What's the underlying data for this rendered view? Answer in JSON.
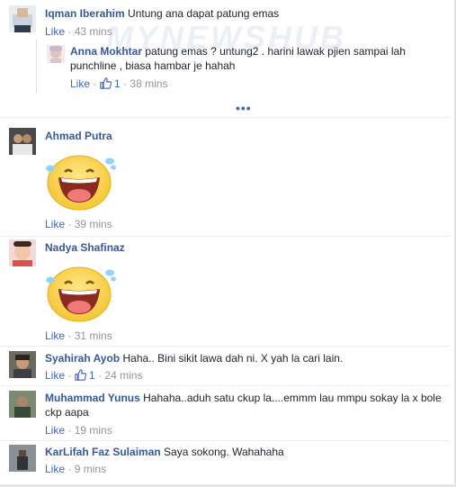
{
  "comments": [
    {
      "name": "Iqman Iberahim",
      "text": "Untung ana dapat patung emas",
      "like": "Like",
      "sep": "·",
      "time": "43 mins"
    },
    {
      "name": "Anna Mokhtar",
      "text": "patung emas ? untung2 . harini lawak pjien sampai lah punchline , biasa hambar je hahah",
      "like": "Like",
      "sep": "·",
      "likes": "1",
      "sep2": "·",
      "time": "38 mins"
    },
    {
      "name": "Ahmad Putra",
      "like": "Like",
      "sep": "·",
      "time": "39 mins",
      "sticker": "laughing-tears-sticker"
    },
    {
      "name": "Nadya Shafinaz",
      "like": "Like",
      "sep": "·",
      "time": "31 mins",
      "sticker": "laughing-tears-sticker"
    },
    {
      "name": "Syahirah Ayob",
      "text": "Haha.. Bini sikit lawa dah ni. X yah la cari lain.",
      "like": "Like",
      "sep": "·",
      "likes": "1",
      "sep2": "·",
      "time": "24 mins"
    },
    {
      "name": "Muhammad Yunus",
      "text": "Hahaha..aduh satu ckup la....emmm lau mmpu sokay la x bole ckp aapa",
      "like": "Like",
      "sep": "·",
      "time": "19 mins"
    },
    {
      "name": "KarLifah Faz Sulaiman",
      "text": "Saya sokong. Wahahaha",
      "like": "Like",
      "sep": "·",
      "time": "9 mins"
    }
  ],
  "more_replies": "•••",
  "colors": {
    "name": "#365899",
    "link": "#4267b2",
    "meta": "#90949c",
    "text": "#1d2129"
  },
  "icons": {
    "thumb": "thumbs-up-icon",
    "more": "more-replies-icon"
  }
}
